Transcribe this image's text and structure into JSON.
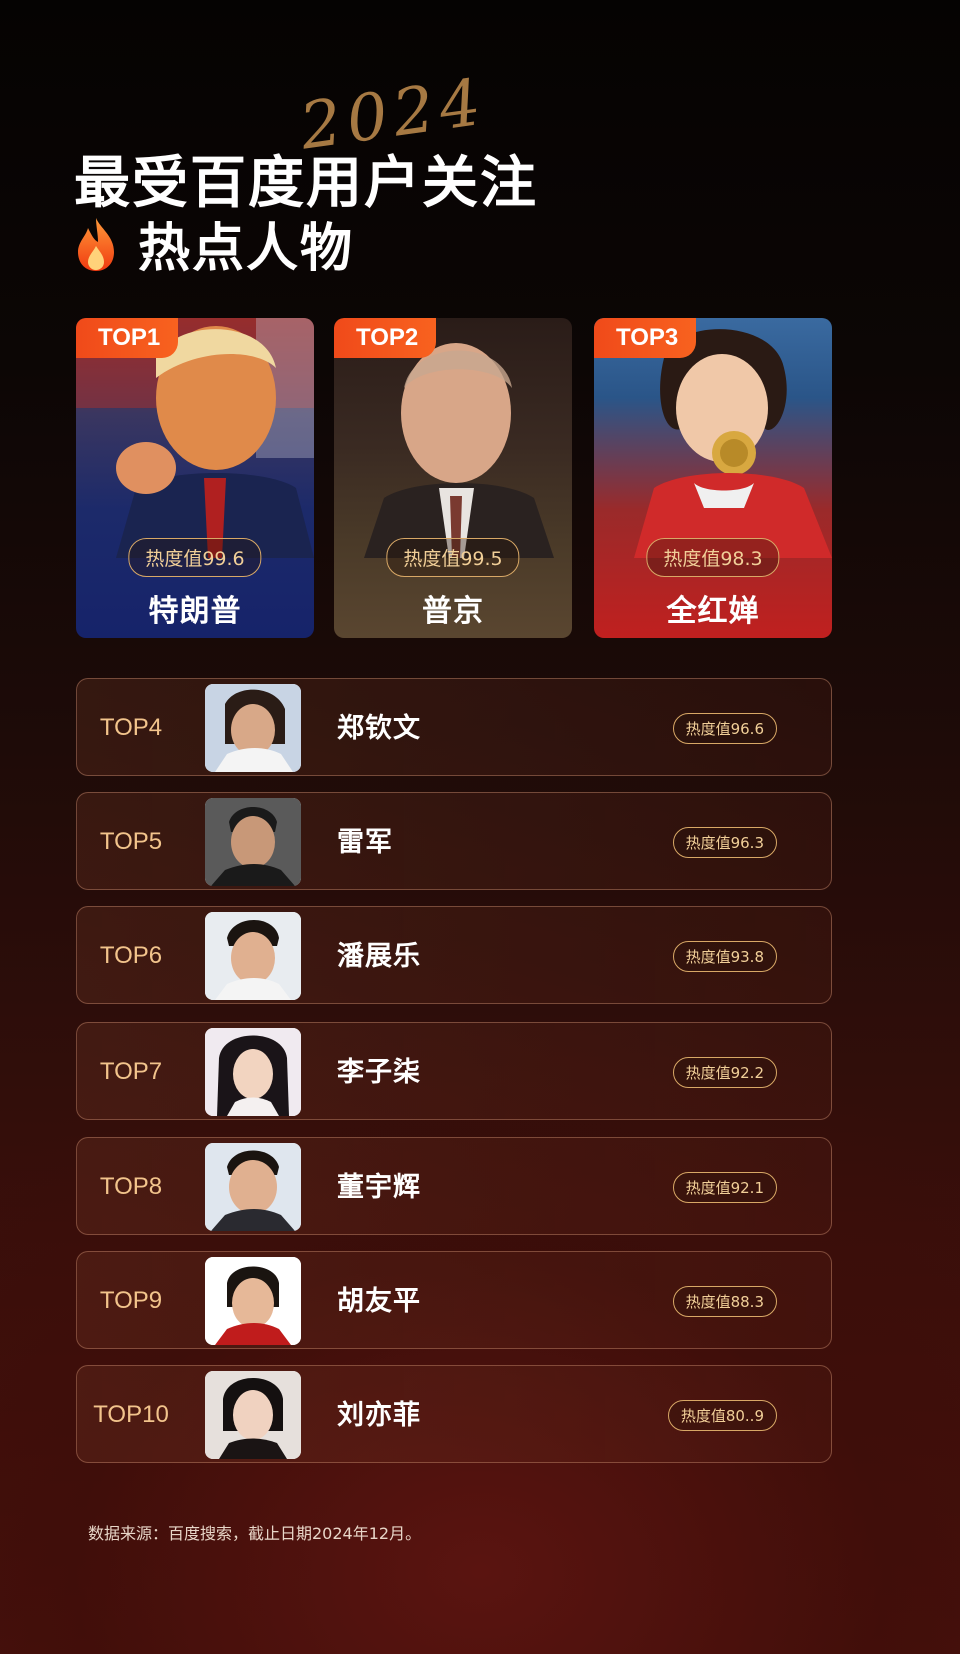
{
  "header": {
    "year_script": "2024",
    "title_line1": "最受百度用户关注",
    "title_line2": "热点人物"
  },
  "top3": [
    {
      "rank": "TOP1",
      "heat": "热度值99.6",
      "name": "特朗普"
    },
    {
      "rank": "TOP2",
      "heat": "热度值99.5",
      "name": "普京"
    },
    {
      "rank": "TOP3",
      "heat": "热度值98.3",
      "name": "全红婵"
    }
  ],
  "list": [
    {
      "rank": "TOP4",
      "name": "郑钦文",
      "heat": "热度值96.6"
    },
    {
      "rank": "TOP5",
      "name": "雷军",
      "heat": "热度值96.3"
    },
    {
      "rank": "TOP6",
      "name": "潘展乐",
      "heat": "热度值93.8"
    },
    {
      "rank": "TOP7",
      "name": "李子柒",
      "heat": "热度值92.2"
    },
    {
      "rank": "TOP8",
      "name": "董宇辉",
      "heat": "热度值92.1"
    },
    {
      "rank": "TOP9",
      "name": "胡友平",
      "heat": "热度值88.3"
    },
    {
      "rank": "TOP10",
      "name": "刘亦菲",
      "heat": "热度值80..9"
    }
  ],
  "footer": "数据来源：百度搜索，截止日期2024年12月。",
  "colors": {
    "accent_orange": "#f04a1a",
    "gold_text": "#f1cf98",
    "rank_text": "#f2c48c",
    "background_dark": "#0a0504",
    "background_red": "#4a120d"
  },
  "icons": {
    "title_icon": "fire-icon"
  }
}
